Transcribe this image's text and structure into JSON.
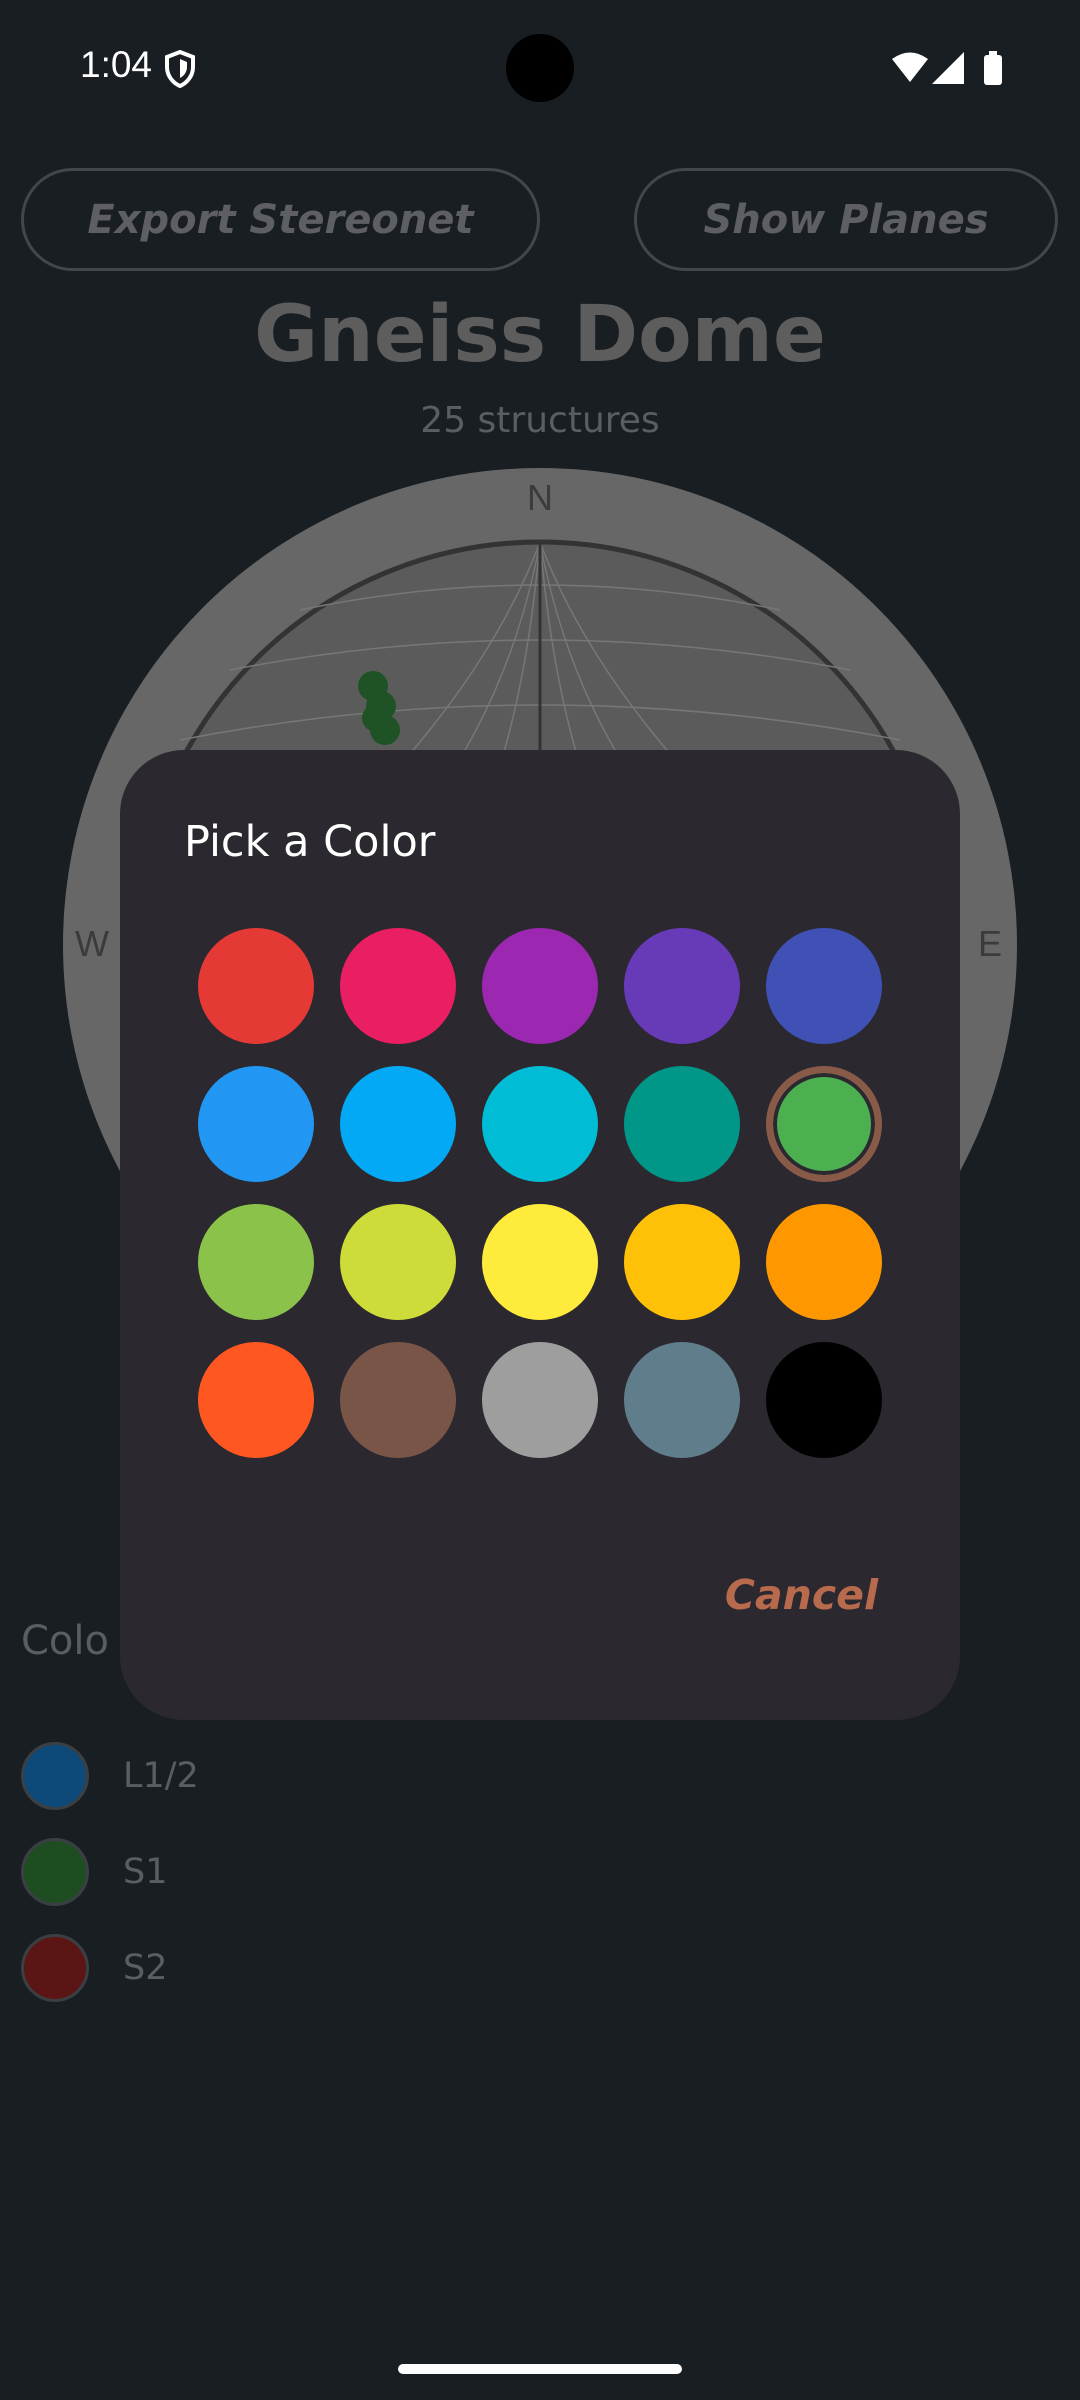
{
  "status_bar": {
    "time": "1:04"
  },
  "toolbar": {
    "export_label": "Export Stereonet",
    "planes_label": "Show Planes"
  },
  "header": {
    "title": "Gneiss Dome",
    "subtitle": "25 structures"
  },
  "stereonet": {
    "north": "N",
    "west": "W",
    "east": "E"
  },
  "legend": {
    "title": "Colo",
    "items": [
      {
        "label": "L1/2",
        "color": "#0d4a7a"
      },
      {
        "label": "S1",
        "color": "#1f4d22"
      },
      {
        "label": "S2",
        "color": "#5c1515"
      }
    ]
  },
  "dialog": {
    "title": "Pick a Color",
    "cancel_label": "Cancel",
    "selected_color": "#4caf50",
    "colors": [
      "#e53935",
      "#e91e63",
      "#9c27b0",
      "#673ab7",
      "#3f51b5",
      "#2196f3",
      "#03a9f4",
      "#00bcd4",
      "#009688",
      "#4caf50",
      "#8bc34a",
      "#cddc39",
      "#ffeb3b",
      "#ffc107",
      "#ff9800",
      "#ff5722",
      "#795548",
      "#9e9e9e",
      "#607d8b",
      "#000000"
    ]
  }
}
